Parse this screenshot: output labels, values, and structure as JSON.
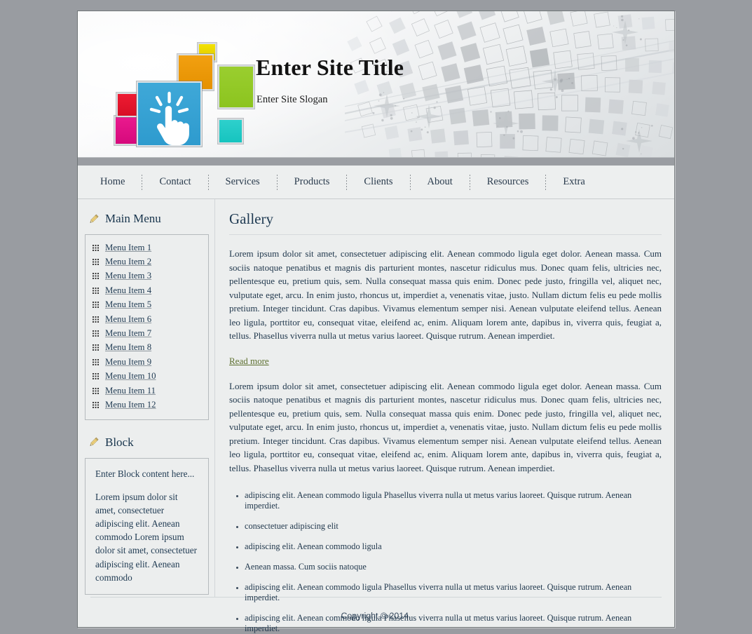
{
  "header": {
    "site_title": "Enter Site Title",
    "site_slogan": "Enter Site Slogan",
    "logo_colors": {
      "yellow": "#f3e200",
      "orange": "#f2a011",
      "green": "#9ace2f",
      "teal": "#2ed0cc",
      "red": "#ee1b32",
      "magenta": "#ea1a8e",
      "blue": "#3fa8d8"
    }
  },
  "nav": {
    "items": [
      {
        "label": "Home"
      },
      {
        "label": "Contact"
      },
      {
        "label": "Services"
      },
      {
        "label": "Products"
      },
      {
        "label": "Clients"
      },
      {
        "label": "About"
      },
      {
        "label": "Resources"
      },
      {
        "label": "Extra"
      }
    ]
  },
  "sidebar": {
    "main_menu_title": "Main Menu",
    "menu_items": [
      {
        "label": "Menu Item 1"
      },
      {
        "label": "Menu Item 2"
      },
      {
        "label": "Menu Item 3"
      },
      {
        "label": "Menu Item 4"
      },
      {
        "label": "Menu Item 5"
      },
      {
        "label": "Menu Item 6"
      },
      {
        "label": "Menu Item 7"
      },
      {
        "label": "Menu Item 8"
      },
      {
        "label": "Menu Item 9"
      },
      {
        "label": "Menu Item 10"
      },
      {
        "label": "Menu Item 11"
      },
      {
        "label": "Menu Item 12"
      }
    ],
    "block_title": "Block",
    "block_intro": "Enter Block content here...",
    "block_body": "Lorem ipsum dolor sit amet, consectetuer adipiscing elit. Aenean commodo Lorem ipsum dolor sit amet, consectetuer adipiscing elit. Aenean commodo"
  },
  "content": {
    "title": "Gallery",
    "paragraph_1": "Lorem ipsum dolor sit amet, consectetuer adipiscing elit. Aenean commodo ligula eget dolor. Aenean massa. Cum sociis natoque penatibus et magnis dis parturient montes, nascetur ridiculus mus. Donec quam felis, ultricies nec, pellentesque eu, pretium quis, sem. Nulla consequat massa quis enim. Donec pede justo, fringilla vel, aliquet nec, vulputate eget, arcu. In enim justo, rhoncus ut, imperdiet a, venenatis vitae, justo. Nullam dictum felis eu pede mollis pretium. Integer tincidunt. Cras dapibus. Vivamus elementum semper nisi. Aenean vulputate eleifend tellus. Aenean leo ligula, porttitor eu, consequat vitae, eleifend ac, enim. Aliquam lorem ante, dapibus in, viverra quis, feugiat a, tellus. Phasellus viverra nulla ut metus varius laoreet. Quisque rutrum. Aenean imperdiet.",
    "read_more_label": "Read more",
    "paragraph_2": "Lorem ipsum dolor sit amet, consectetuer adipiscing elit. Aenean commodo ligula eget dolor. Aenean massa. Cum sociis natoque penatibus et magnis dis parturient montes, nascetur ridiculus mus. Donec quam felis, ultricies nec, pellentesque eu, pretium quis, sem. Nulla consequat massa quis enim. Donec pede justo, fringilla vel, aliquet nec, vulputate eget, arcu. In enim justo, rhoncus ut, imperdiet a, venenatis vitae, justo. Nullam dictum felis eu pede mollis pretium. Integer tincidunt. Cras dapibus. Vivamus elementum semper nisi. Aenean vulputate eleifend tellus. Aenean leo ligula, porttitor eu, consequat vitae, eleifend ac, enim. Aliquam lorem ante, dapibus in, viverra quis, feugiat a, tellus. Phasellus viverra nulla ut metus varius laoreet. Quisque rutrum. Aenean imperdiet.",
    "bullets": [
      {
        "text": "adipiscing elit. Aenean commodo ligula Phasellus viverra nulla ut metus varius laoreet. Quisque rutrum. Aenean imperdiet."
      },
      {
        "text": "consectetuer adipiscing elit"
      },
      {
        "text": "adipiscing elit. Aenean commodo ligula"
      },
      {
        "text": "Aenean massa. Cum sociis natoque"
      },
      {
        "text": "adipiscing elit. Aenean commodo ligula Phasellus viverra nulla ut metus varius laoreet. Quisque rutrum. Aenean imperdiet."
      },
      {
        "text": "adipiscing elit. Aenean commodo ligula Phasellus viverra nulla ut metus varius laoreet. Quisque rutrum. Aenean imperdiet."
      }
    ]
  },
  "footer": {
    "copyright": "Copyright © 2014."
  },
  "icons": {
    "edit_pencil": "pencil-icon",
    "menu_bullet": "grid-dots-icon",
    "logo_click": "pointing-hand-click-icon"
  }
}
